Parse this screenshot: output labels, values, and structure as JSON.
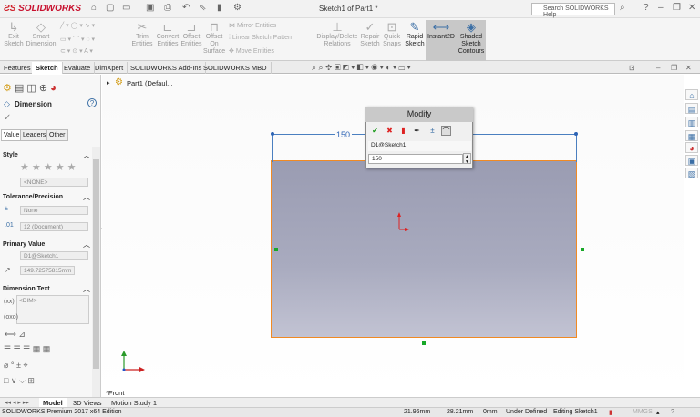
{
  "app": {
    "brand": "SOLIDWORKS",
    "title": "Sketch1 of Part1 *",
    "search_placeholder": "Search SOLIDWORKS Help"
  },
  "ribbon": {
    "exit_sketch": "Exit Sketch",
    "smart_dimension": "Smart Dimension",
    "trim_entities": "Trim Entities",
    "convert_entities": "Convert Entities",
    "offset_entities": "Offset Entities",
    "offset_on_surface": "Offset On Surface",
    "mirror_entities": "Mirror Entities",
    "linear_sketch_pattern": "Linear Sketch Pattern",
    "move_entities": "Move Entities",
    "display_delete_relations": "Display/Delete Relations",
    "repair_sketch": "Repair Sketch",
    "quick_snaps": "Quick Snaps",
    "rapid_sketch": "Rapid Sketch",
    "instant2d": "Instant2D",
    "shaded_sketch_contours": "Shaded Sketch Contours"
  },
  "tabs": [
    "Features",
    "Sketch",
    "Evaluate",
    "DimXpert",
    "SOLIDWORKS Add-Ins",
    "SOLIDWORKS MBD"
  ],
  "tree": {
    "root": "Part1  (Defaul..."
  },
  "panel": {
    "title": "Dimension",
    "subtabs": [
      "Value",
      "Leaders",
      "Other"
    ],
    "style_label": "Style",
    "style_value": "<NONE>",
    "tolerance_label": "Tolerance/Precision",
    "tolerance_value": "None",
    "precision_value": "12 (Document)",
    "primary_label": "Primary Value",
    "primary_name": "D1@Sketch1",
    "primary_value": "149.72575815mm",
    "dimtext_label": "Dimension Text",
    "dimtext_value": "<DIM>"
  },
  "modify": {
    "title": "Modify",
    "name": "D1@Sketch1",
    "value": "150"
  },
  "sketch": {
    "dimension_text": "150",
    "view_label": "*Front"
  },
  "bottom_tabs": [
    "Model",
    "3D Views",
    "Motion Study 1"
  ],
  "status": {
    "edition": "SOLIDWORKS Premium 2017 x64 Edition",
    "x": "21.96mm",
    "y": "28.21mm",
    "z": "0mm",
    "state": "Under Defined",
    "editing": "Editing Sketch1",
    "units": "MMGS"
  },
  "colors": {
    "accent": "#3a6ea5",
    "sketch_edge": "#f08a24",
    "dimension": "#2f65b5",
    "brand": "#c8102e"
  }
}
